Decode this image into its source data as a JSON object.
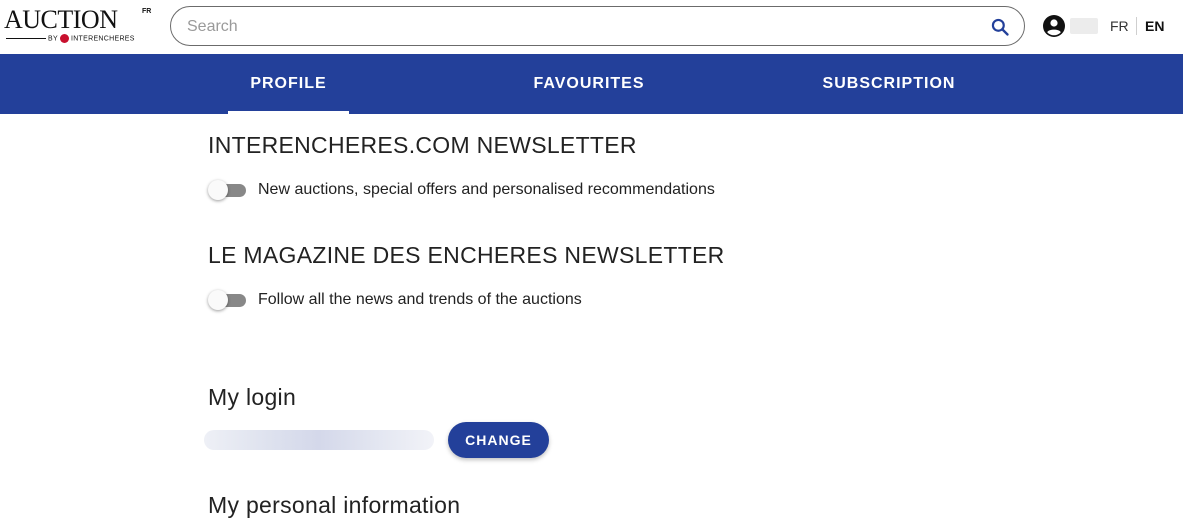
{
  "header": {
    "logo": {
      "word": "AUCTION",
      "badge": "FR",
      "by": "BY",
      "brand": "INTERENCHERES"
    },
    "search": {
      "placeholder": "Search",
      "value": ""
    },
    "languages": [
      "FR",
      "EN"
    ],
    "active_language": "EN"
  },
  "tabs": [
    {
      "label": "PROFILE",
      "active": true
    },
    {
      "label": "FAVOURITES",
      "active": false
    },
    {
      "label": "SUBSCRIPTION",
      "active": false
    }
  ],
  "newsletters": [
    {
      "title": "INTERENCHERES.COM NEWSLETTER",
      "toggle_label": "New auctions, special offers and personalised recommendations",
      "enabled": false
    },
    {
      "title": "LE MAGAZINE DES ENCHERES NEWSLETTER",
      "toggle_label": "Follow all the news and trends of the auctions",
      "enabled": false
    }
  ],
  "login": {
    "title": "My login",
    "change_label": "CHANGE"
  },
  "personal_info": {
    "title": "My personal information"
  },
  "colors": {
    "brand_blue": "#23409a",
    "toggle_off_track": "#888888",
    "logo_red": "#c8102e"
  },
  "icons": {
    "search": "search-icon",
    "user": "account-circle-icon"
  }
}
